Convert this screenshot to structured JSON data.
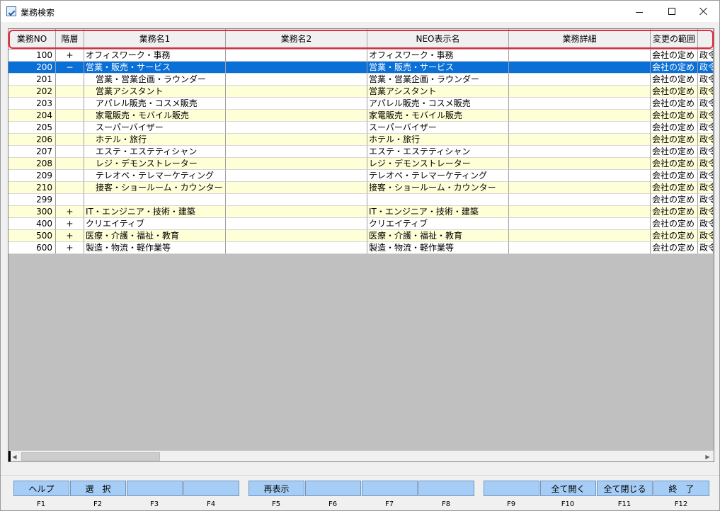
{
  "window": {
    "title": "業務検索"
  },
  "columns": [
    {
      "key": "no",
      "label": "業務NO"
    },
    {
      "key": "level",
      "label": "階層"
    },
    {
      "key": "name1",
      "label": "業務名1"
    },
    {
      "key": "name2",
      "label": "業務名2"
    },
    {
      "key": "neo",
      "label": "NEO表示名"
    },
    {
      "key": "detail",
      "label": "業務詳細"
    },
    {
      "key": "range",
      "label": "変更の範囲"
    },
    {
      "key": "extra",
      "label": ""
    }
  ],
  "rows": [
    {
      "no": "100",
      "level": "+",
      "name1": "オフィスワーク・事務",
      "name2": "",
      "neo": "オフィスワーク・事務",
      "detail": "",
      "range": "会社の定め",
      "extra": "政令"
    },
    {
      "no": "200",
      "level": "−",
      "name1": "営業・販売・サービス",
      "name2": "",
      "neo": "営業・販売・サービス",
      "detail": "",
      "range": "会社の定め",
      "extra": "政令",
      "selected": true
    },
    {
      "no": "201",
      "level": "",
      "name1": "営業・営業企画・ラウンダー",
      "name2": "",
      "neo": "営業・営業企画・ラウンダー",
      "detail": "",
      "range": "会社の定め",
      "extra": "政令",
      "child": true
    },
    {
      "no": "202",
      "level": "",
      "name1": "営業アシスタント",
      "name2": "",
      "neo": "営業アシスタント",
      "detail": "",
      "range": "会社の定め",
      "extra": "政令",
      "child": true
    },
    {
      "no": "203",
      "level": "",
      "name1": "アパレル販売・コスメ販売",
      "name2": "",
      "neo": "アパレル販売・コスメ販売",
      "detail": "",
      "range": "会社の定め",
      "extra": "政令",
      "child": true
    },
    {
      "no": "204",
      "level": "",
      "name1": "家電販売・モバイル販売",
      "name2": "",
      "neo": "家電販売・モバイル販売",
      "detail": "",
      "range": "会社の定め",
      "extra": "政令",
      "child": true
    },
    {
      "no": "205",
      "level": "",
      "name1": "スーパーバイザー",
      "name2": "",
      "neo": "スーパーバイザー",
      "detail": "",
      "range": "会社の定め",
      "extra": "政令",
      "child": true
    },
    {
      "no": "206",
      "level": "",
      "name1": "ホテル・旅行",
      "name2": "",
      "neo": "ホテル・旅行",
      "detail": "",
      "range": "会社の定め",
      "extra": "政令",
      "child": true
    },
    {
      "no": "207",
      "level": "",
      "name1": "エステ・エステティシャン",
      "name2": "",
      "neo": "エステ・エステティシャン",
      "detail": "",
      "range": "会社の定め",
      "extra": "政令",
      "child": true
    },
    {
      "no": "208",
      "level": "",
      "name1": "レジ・デモンストレーター",
      "name2": "",
      "neo": "レジ・デモンストレーター",
      "detail": "",
      "range": "会社の定め",
      "extra": "政令",
      "child": true
    },
    {
      "no": "209",
      "level": "",
      "name1": "テレオペ・テレマーケティング",
      "name2": "",
      "neo": "テレオペ・テレマーケティング",
      "detail": "",
      "range": "会社の定め",
      "extra": "政令",
      "child": true
    },
    {
      "no": "210",
      "level": "",
      "name1": "接客・ショールーム・カウンター",
      "name2": "",
      "neo": "接客・ショールーム・カウンター",
      "detail": "",
      "range": "会社の定め",
      "extra": "政令",
      "child": true
    },
    {
      "no": "299",
      "level": "",
      "name1": "",
      "name2": "",
      "neo": "",
      "detail": "",
      "range": "会社の定め",
      "extra": "政令",
      "child": true
    },
    {
      "no": "300",
      "level": "+",
      "name1": "IT・エンジニア・技術・建築",
      "name2": "",
      "neo": "IT・エンジニア・技術・建築",
      "detail": "",
      "range": "会社の定め",
      "extra": "政令"
    },
    {
      "no": "400",
      "level": "+",
      "name1": "クリエイティブ",
      "name2": "",
      "neo": "クリエイティブ",
      "detail": "",
      "range": "会社の定め",
      "extra": "政令"
    },
    {
      "no": "500",
      "level": "+",
      "name1": "医療・介護・福祉・教育",
      "name2": "",
      "neo": "医療・介護・福祉・教育",
      "detail": "",
      "range": "会社の定め",
      "extra": "政令"
    },
    {
      "no": "600",
      "level": "+",
      "name1": "製造・物流・軽作業等",
      "name2": "",
      "neo": "製造・物流・軽作業等",
      "detail": "",
      "range": "会社の定め",
      "extra": "政令"
    }
  ],
  "fkeys": [
    {
      "key": "F1",
      "label": "ヘルプ"
    },
    {
      "key": "F2",
      "label": "選　択"
    },
    {
      "key": "F3",
      "label": ""
    },
    {
      "key": "F4",
      "label": ""
    },
    {
      "key": "F5",
      "label": "再表示"
    },
    {
      "key": "F6",
      "label": ""
    },
    {
      "key": "F7",
      "label": ""
    },
    {
      "key": "F8",
      "label": ""
    },
    {
      "key": "F9",
      "label": ""
    },
    {
      "key": "F10",
      "label": "全て開く"
    },
    {
      "key": "F11",
      "label": "全て閉じる"
    },
    {
      "key": "F12",
      "label": "終　了"
    }
  ],
  "colors": {
    "selected": "#0a6fd6",
    "alt_row": "#ffffd7",
    "fkey": "#a6cdf5",
    "highlight": "#e8283b"
  }
}
